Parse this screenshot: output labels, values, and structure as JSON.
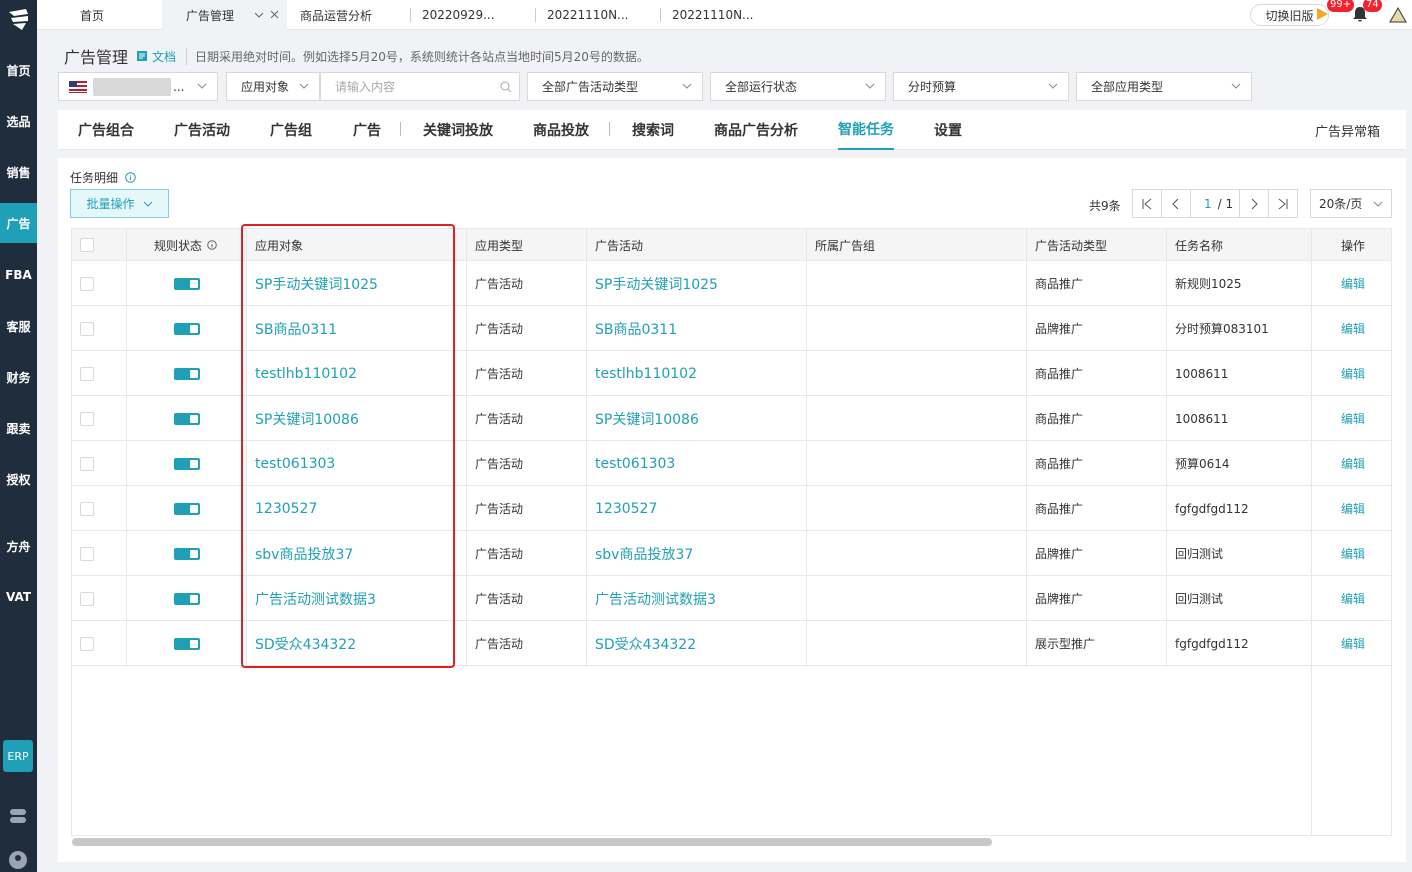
{
  "left_nav": {
    "items": [
      "首页",
      "选品",
      "销售",
      "广告",
      "FBA",
      "客服",
      "财务",
      "跟卖",
      "授权",
      "方舟",
      "VAT"
    ],
    "erp": "ERP"
  },
  "top_tabs": [
    {
      "label": "首页"
    },
    {
      "label": "广告管理",
      "active": true
    },
    {
      "label": "商品运营分析"
    },
    {
      "label": "20220929..."
    },
    {
      "label": "20221110N..."
    },
    {
      "label": "20221110N..."
    }
  ],
  "topbar": {
    "switch_old": "切换旧版",
    "flag_badge": "99+",
    "bell_badge": "74"
  },
  "header": {
    "title": "广告管理",
    "doc": "文档",
    "hint": "日期采用绝对时间。例如选择5月20号，系统则统计各站点当地时间5月20号的数据。"
  },
  "filters": {
    "store": "...",
    "apply_object": "应用对象",
    "search_placeholder": "请输入内容",
    "campaign_type": "全部广告活动类型",
    "run_state": "全部运行状态",
    "budget": "分时预算",
    "apply_type": "全部应用类型"
  },
  "subnav": {
    "items": [
      "广告组合",
      "广告活动",
      "广告组",
      "广告",
      "关键词投放",
      "商品投放",
      "搜索词",
      "商品广告分析",
      "智能任务",
      "设置"
    ],
    "active": "智能任务",
    "right": "广告异常箱"
  },
  "section": {
    "title": "任务明细",
    "bulk": "批量操作"
  },
  "pager": {
    "total": "共9条",
    "current": "1",
    "pages": "/ 1",
    "size": "20条/页"
  },
  "table": {
    "columns": [
      "规则状态",
      "应用对象",
      "应用类型",
      "广告活动",
      "所属广告组",
      "广告活动类型",
      "任务名称",
      "操作"
    ],
    "rows": [
      {
        "object": "SP手动关键词1025",
        "type": "广告活动",
        "campaign": "SP手动关键词1025",
        "group": "",
        "ctype": "商品推广",
        "task": "新规则1025",
        "op": "编辑"
      },
      {
        "object": "SB商品0311",
        "type": "广告活动",
        "campaign": "SB商品0311",
        "group": "",
        "ctype": "品牌推广",
        "task": "分时预算083101",
        "op": "编辑"
      },
      {
        "object": "testlhb110102",
        "type": "广告活动",
        "campaign": "testlhb110102",
        "group": "",
        "ctype": "商品推广",
        "task": "1008611",
        "op": "编辑"
      },
      {
        "object": "SP关键词10086",
        "type": "广告活动",
        "campaign": "SP关键词10086",
        "group": "",
        "ctype": "商品推广",
        "task": "1008611",
        "op": "编辑"
      },
      {
        "object": "test061303",
        "type": "广告活动",
        "campaign": "test061303",
        "group": "",
        "ctype": "商品推广",
        "task": "预算0614",
        "op": "编辑"
      },
      {
        "object": "1230527",
        "type": "广告活动",
        "campaign": "1230527",
        "group": "",
        "ctype": "商品推广",
        "task": "fgfgdfgd112",
        "op": "编辑"
      },
      {
        "object": "sbv商品投放37",
        "type": "广告活动",
        "campaign": "sbv商品投放37",
        "group": "",
        "ctype": "品牌推广",
        "task": "回归测试",
        "op": "编辑"
      },
      {
        "object": "广告活动测试数据3",
        "type": "广告活动",
        "campaign": "广告活动测试数据3",
        "group": "",
        "ctype": "品牌推广",
        "task": "回归测试",
        "op": "编辑"
      },
      {
        "object": "SD受众434322",
        "type": "广告活动",
        "campaign": "SD受众434322",
        "group": "",
        "ctype": "展示型推广",
        "task": "fgfgdfgd112",
        "op": "编辑"
      }
    ]
  },
  "colors": {
    "accent": "#1fa0b6",
    "nav_bg": "#1f2d3d",
    "highlight": "#e02020"
  }
}
